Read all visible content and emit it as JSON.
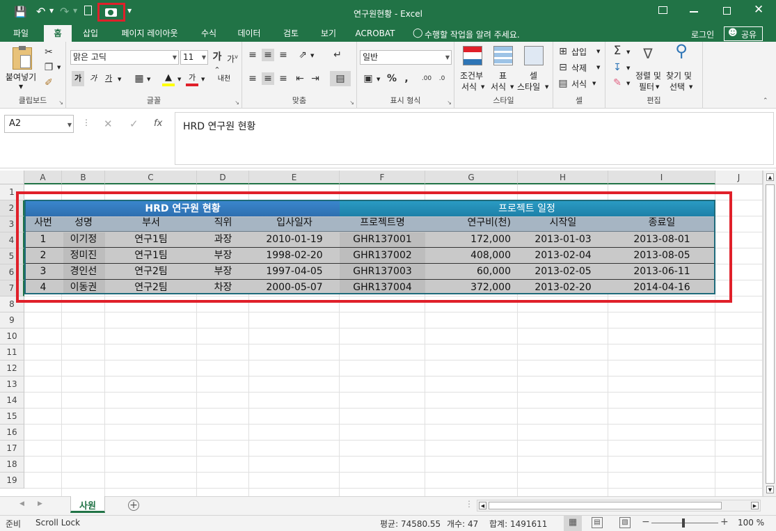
{
  "window": {
    "title": "연구원현황 - Excel"
  },
  "ribbon_tabs": [
    "파일",
    "홈",
    "삽입",
    "페이지 레이아웃",
    "수식",
    "데이터",
    "검토",
    "보기",
    "ACROBAT"
  ],
  "active_tab": "홈",
  "tellme": "수행할 작업을 알려 주세요.",
  "login": "로그인",
  "share": "공유",
  "clipboard": {
    "paste": "붙여넣기",
    "label": "클립보드"
  },
  "font": {
    "name": "맑은 고딕",
    "size": "11",
    "label": "글꼴",
    "bold": "가",
    "italic": "가",
    "underline": "가",
    "color": "가",
    "phonetic": "내천"
  },
  "align": {
    "label": "맞춤"
  },
  "number": {
    "format": "일반",
    "label": "표시 형식"
  },
  "styles": {
    "conditional": "조건부",
    "conditional2": "서식",
    "table": "표",
    "table2": "서식",
    "cell": "셀",
    "cell2": "스타일",
    "label": "스타일"
  },
  "cells": {
    "insert": "삽입",
    "delete": "삭제",
    "format": "서식",
    "label": "셀"
  },
  "editing": {
    "sort": "정렬 및",
    "sort2": "필터",
    "find": "찾기 및",
    "find2": "선택",
    "label": "편집"
  },
  "formula_bar": {
    "name_box": "A2",
    "fx": "fx",
    "content": "HRD 연구원 현황"
  },
  "columns": [
    "A",
    "B",
    "C",
    "D",
    "E",
    "F",
    "G",
    "H",
    "I",
    "J"
  ],
  "rows": [
    "1",
    "2",
    "3",
    "4",
    "5",
    "6",
    "7",
    "8",
    "9",
    "10",
    "11",
    "12",
    "13",
    "14",
    "15",
    "16",
    "17",
    "18",
    "19"
  ],
  "table": {
    "title_left": "HRD 연구원 현황",
    "title_right": "프로젝트 일정",
    "headers": [
      "사번",
      "성명",
      "부서",
      "직위",
      "입사일자",
      "프로젝트명",
      "연구비(천)",
      "시작일",
      "종료일"
    ],
    "rows": [
      [
        "1",
        "이기정",
        "연구1팀",
        "과장",
        "2010-01-19",
        "GHR137001",
        "172,000",
        "2013-01-03",
        "2013-08-01"
      ],
      [
        "2",
        "정미진",
        "연구1팀",
        "부장",
        "1998-02-20",
        "GHR137002",
        "408,000",
        "2013-02-04",
        "2013-08-05"
      ],
      [
        "3",
        "경인선",
        "연구2팀",
        "부장",
        "1997-04-05",
        "GHR137003",
        "60,000",
        "2013-02-05",
        "2013-06-11"
      ],
      [
        "4",
        "이동권",
        "연구2팀",
        "차장",
        "2000-05-07",
        "GHR137004",
        "372,000",
        "2013-02-20",
        "2014-04-16"
      ]
    ]
  },
  "sheet_tab": "사원",
  "status": {
    "ready": "준비",
    "scroll_lock": "Scroll Lock",
    "average": "평균: 74580.55",
    "count": "개수: 47",
    "sum": "합계: 1491611",
    "zoom": "100 %"
  },
  "colors": {
    "excel_green": "#217346",
    "title_blue": "#2e75b6",
    "title_teal": "#1f8fb5",
    "header_fill": "#a6b5c3",
    "row_fill": "#c9c9c9",
    "highlight_red": "#e0202a"
  }
}
